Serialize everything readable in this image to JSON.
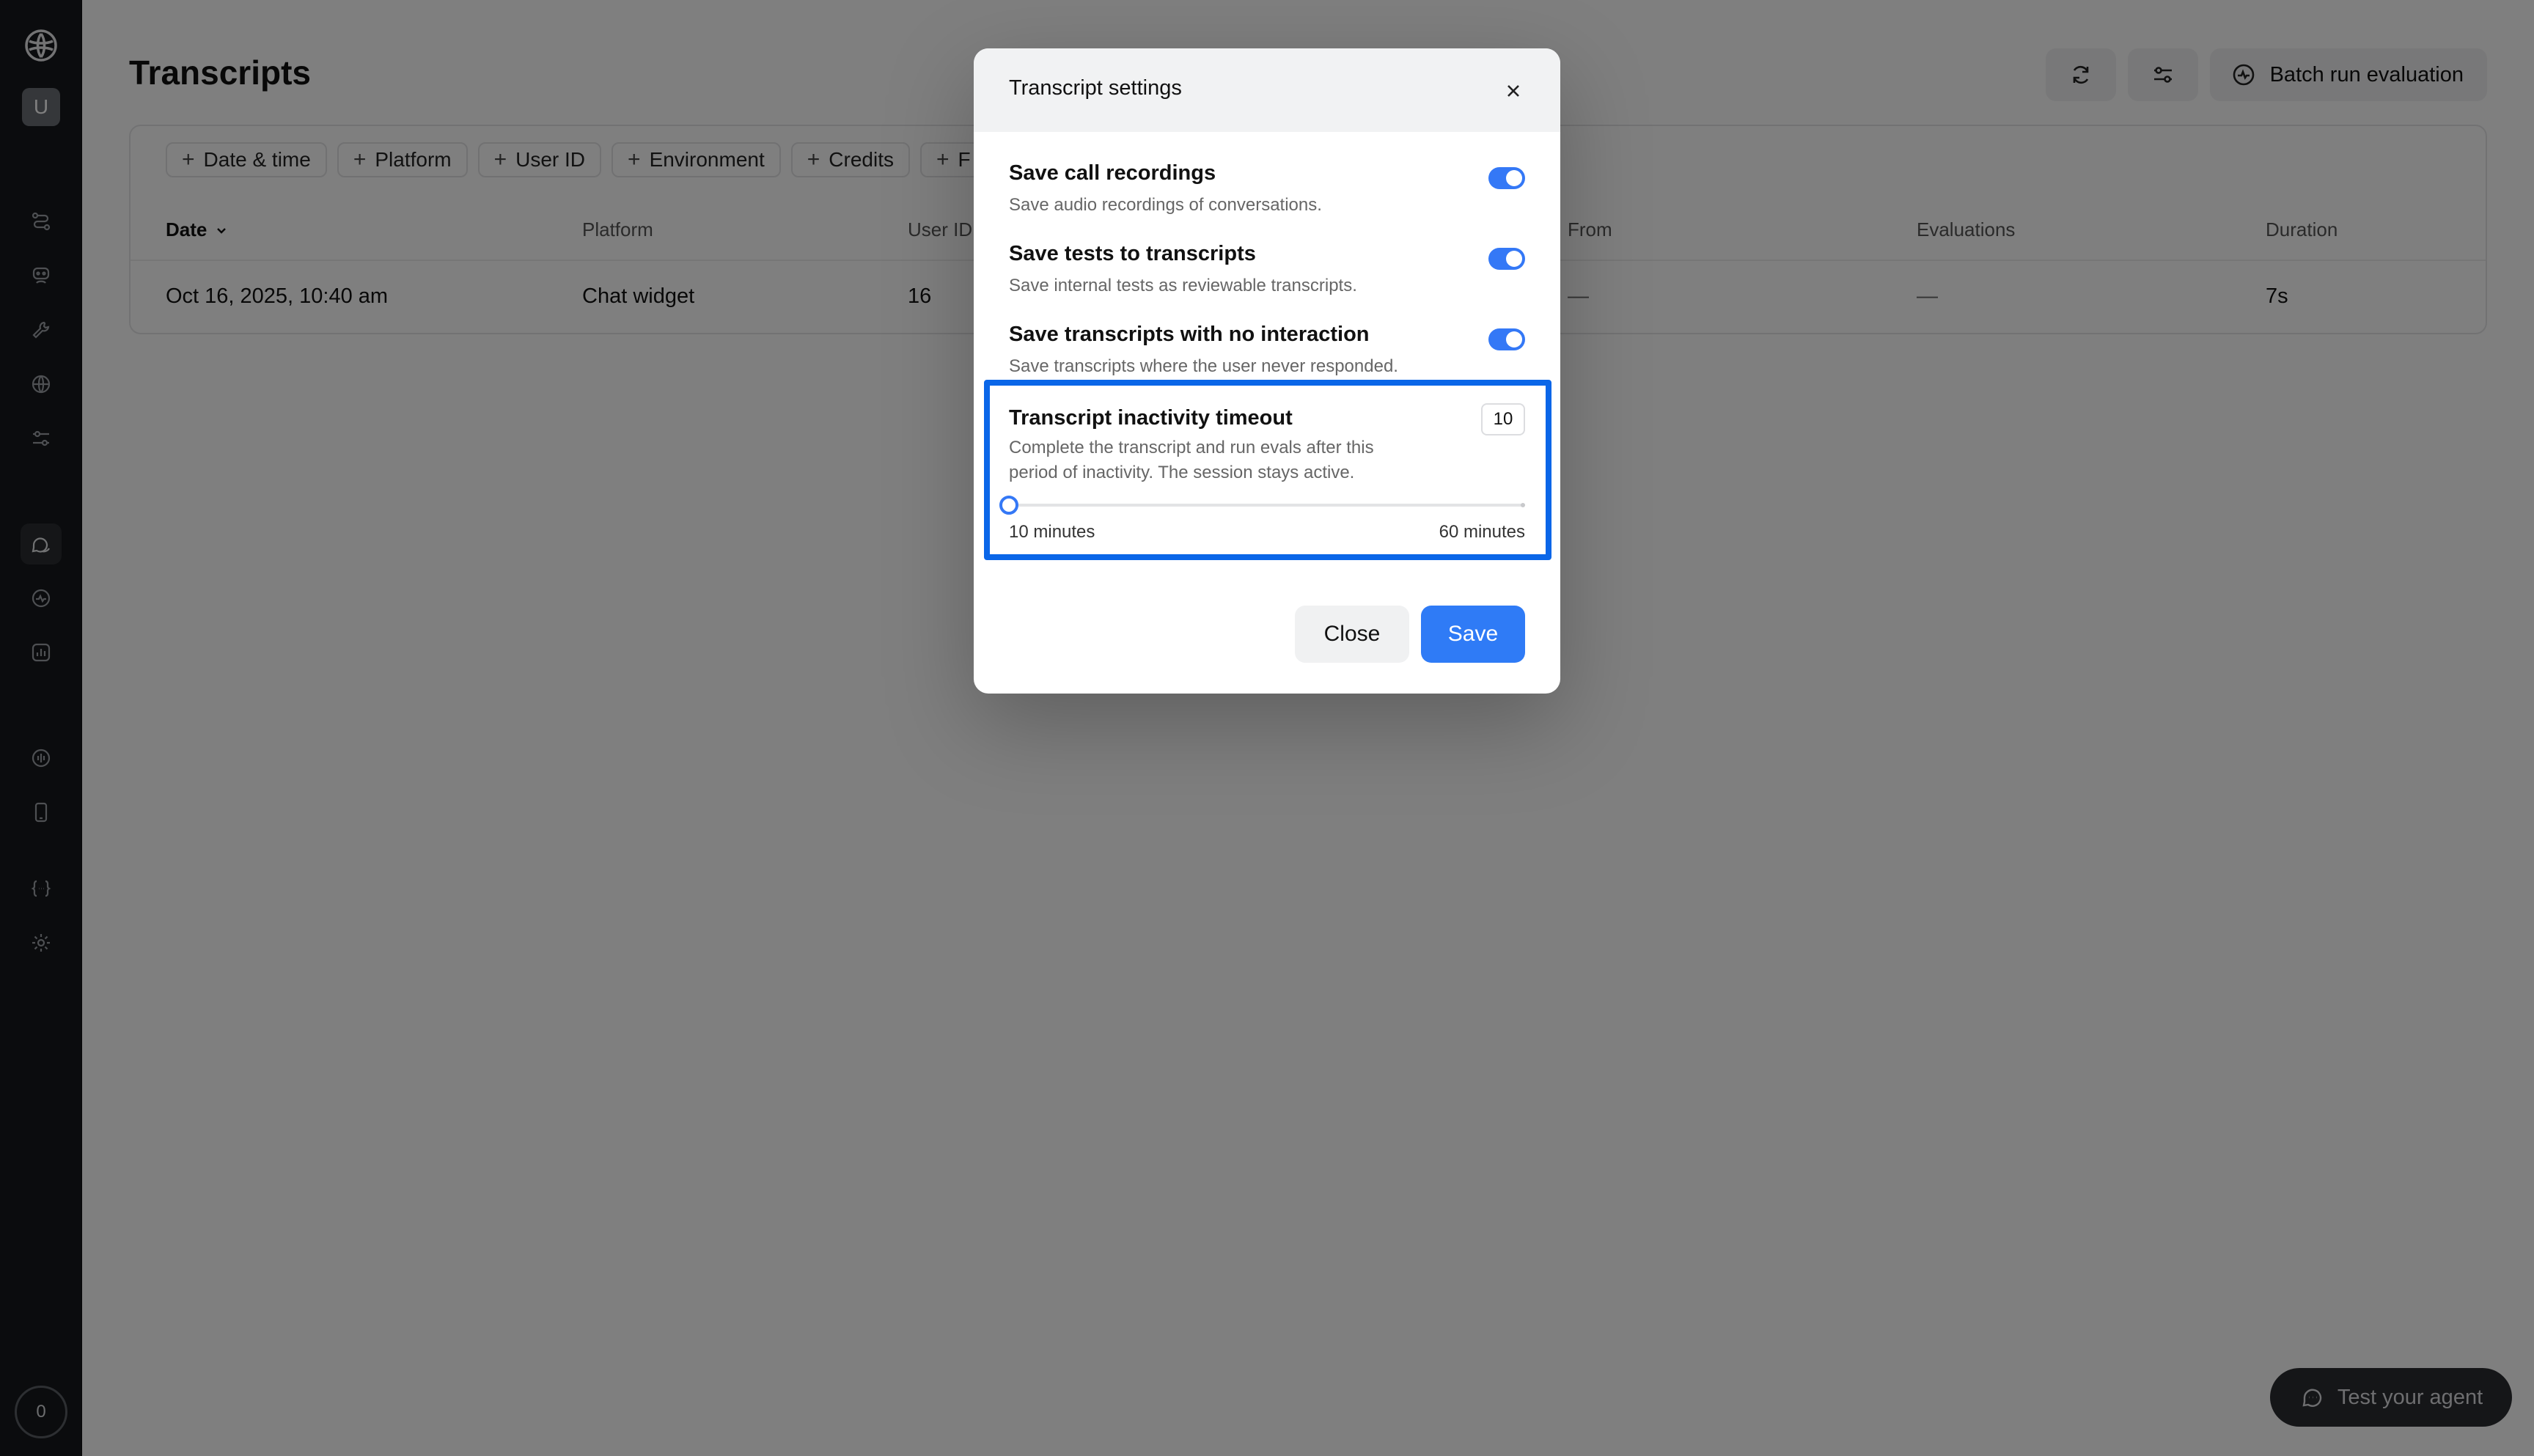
{
  "sidebar": {
    "user_initial": "U",
    "credits": "0",
    "icons": [
      "logo-icon",
      "workflow-icon",
      "agents-icon",
      "tools-icon",
      "knowledge-icon",
      "settings-sliders-icon",
      "chat-transcripts-icon",
      "evaluations-icon",
      "analytics-icon",
      "voice-icon",
      "phone-icon",
      "variables-icon",
      "gear-icon"
    ]
  },
  "page": {
    "title": "Transcripts",
    "batch_label": "Batch run evaluation",
    "test_agent_label": "Test your agent"
  },
  "filters": [
    "Date & time",
    "Platform",
    "User ID",
    "Environment",
    "Credits",
    "F"
  ],
  "table": {
    "columns": {
      "date": "Date",
      "platform": "Platform",
      "user_id": "User ID",
      "from": "From",
      "evaluations": "Evaluations",
      "duration": "Duration"
    },
    "rows": [
      {
        "date": "Oct 16, 2025, 10:40 am",
        "platform": "Chat widget",
        "user_id": "16",
        "from": "—",
        "evaluations": "—",
        "duration": "7s"
      }
    ]
  },
  "modal": {
    "title": "Transcript settings",
    "settings": [
      {
        "title": "Save call recordings",
        "desc": "Save audio recordings of conversations.",
        "enabled": true
      },
      {
        "title": "Save tests to transcripts",
        "desc": "Save internal tests as reviewable transcripts.",
        "enabled": true
      },
      {
        "title": "Save transcripts with no interaction",
        "desc": "Save transcripts where the user never responded.",
        "enabled": true
      }
    ],
    "timeout": {
      "title": "Transcript inactivity timeout",
      "desc": "Complete the transcript and run evals after this period of inactivity. The session stays active.",
      "value": "10",
      "min_label": "10 minutes",
      "max_label": "60 minutes",
      "slider_fraction": 0
    },
    "close_label": "Close",
    "save_label": "Save"
  },
  "colors": {
    "accent": "#3478f6",
    "highlight": "#0a66e8",
    "sidebar_bg": "#17191c"
  }
}
